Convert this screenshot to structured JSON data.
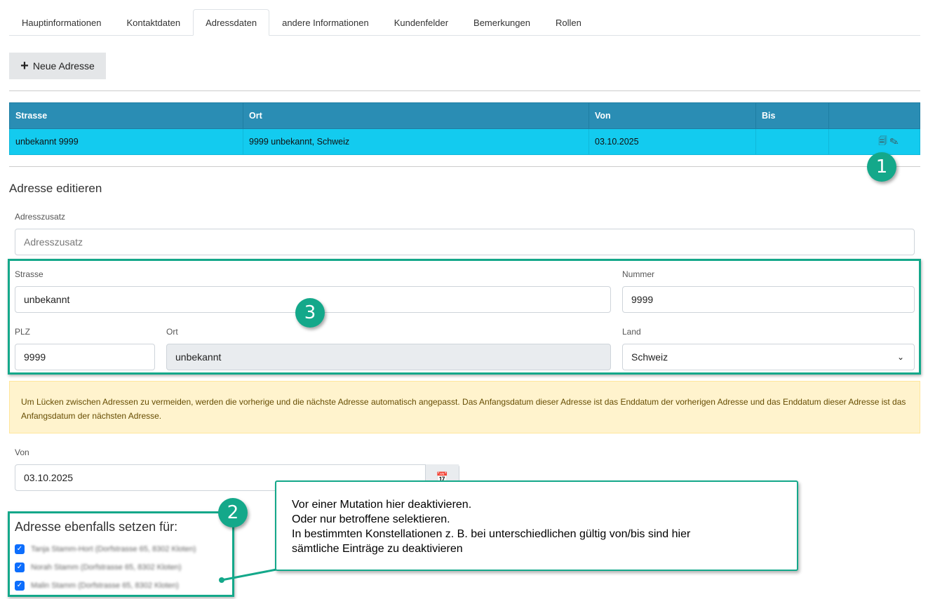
{
  "tabs": [
    "Hauptinformationen",
    "Kontaktdaten",
    "Adressdaten",
    "andere Informationen",
    "Kundenfelder",
    "Bemerkungen",
    "Rollen"
  ],
  "new_address_label": "Neue Adresse",
  "table": {
    "headers": [
      "Strasse",
      "Ort",
      "Von",
      "Bis",
      ""
    ],
    "rows": [
      [
        "unbekannt 9999",
        "9999 unbekannt, Schweiz",
        "03.10.2025",
        ""
      ]
    ]
  },
  "edit_title": "Adresse editieren",
  "form": {
    "adresszusatz_label": "Adresszusatz",
    "adresszusatz_placeholder": "Adresszusatz",
    "strasse_label": "Strasse",
    "strasse": "unbekannt",
    "nummer_label": "Nummer",
    "nummer": "9999",
    "plz_label": "PLZ",
    "plz": "9999",
    "ort_label": "Ort",
    "ort": "unbekannt",
    "land_label": "Land",
    "land": "Schweiz",
    "von_label": "Von",
    "von": "03.10.2025"
  },
  "alert": "Um Lücken zwischen Adressen zu vermeiden, werden die vorherige und die nächste Adresse automatisch angepasst. Das Anfangsdatum dieser Adresse ist das Enddatum der vorherigen Adresse und das Enddatum dieser Adresse ist das Anfangsdatum der nächsten Adresse.",
  "also_set_title": "Adresse ebenfalls setzen für:",
  "persons": [
    "Tanja Stamm-Hort (Dorfstrasse 65, 8302 Kloten)",
    "Norah Stamm (Dorfstrasse 65, 8302 Kloten)",
    "Malin Stamm (Dorfstrasse 65, 8302 Kloten)"
  ],
  "badges": [
    "1",
    "2",
    "3"
  ],
  "callout": [
    "Vor einer Mutation hier deaktivieren.",
    "Oder nur betroffene selektieren.",
    "In bestimmten Konstellationen z. B. bei unterschiedlichen gültig von/bis sind hier",
    "sämtliche Einträge zu deaktivieren"
  ]
}
